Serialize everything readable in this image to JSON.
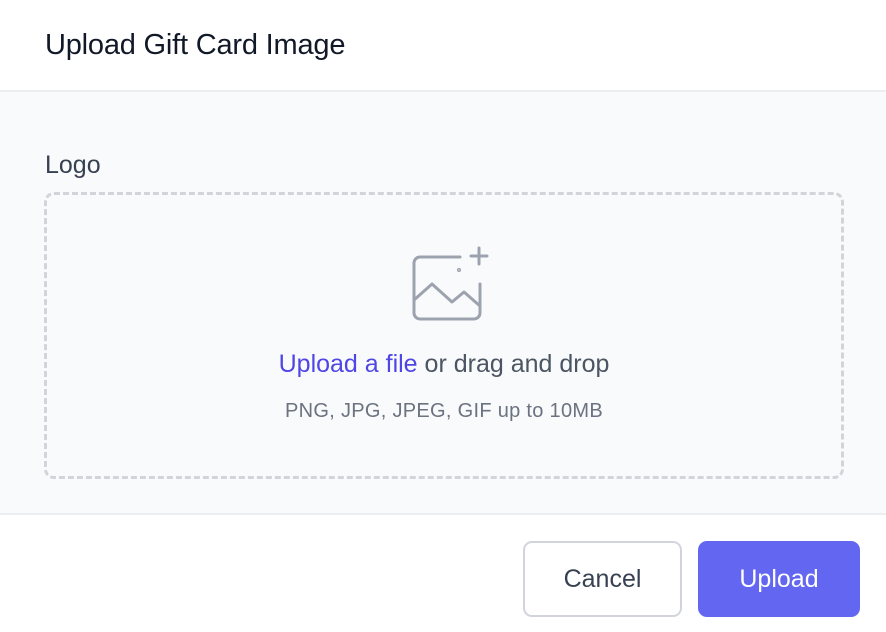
{
  "dialog": {
    "title": "Upload Gift Card Image"
  },
  "form": {
    "field_label": "Logo",
    "dropzone": {
      "icon": "image-add-icon",
      "upload_link": "Upload a file",
      "drag_text": " or drag and drop",
      "hint": "PNG, JPG, JPEG, GIF up to 10MB"
    }
  },
  "footer": {
    "cancel_label": "Cancel",
    "upload_label": "Upload"
  },
  "colors": {
    "accent": "#6366f1",
    "link": "#4f46e5",
    "body_bg": "#f9fafb",
    "border": "#d1d5db"
  }
}
